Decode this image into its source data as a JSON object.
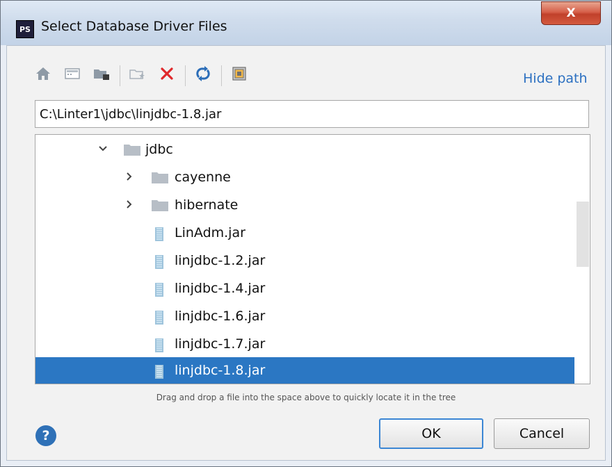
{
  "window": {
    "title": "Select Database Driver Files",
    "app_icon_label": "PS",
    "close_glyph": "X"
  },
  "toolbar": {
    "icons": [
      "home-icon",
      "desktop-icon",
      "project-folder-icon",
      "new-folder-icon",
      "delete-icon",
      "refresh-icon",
      "show-hidden-icon"
    ],
    "hide_path_label": "Hide path"
  },
  "path": {
    "value": "C:\\Linter1\\jdbc\\linjdbc-1.8.jar"
  },
  "tree": {
    "items": [
      {
        "label": "jdbc",
        "type": "folder",
        "expanded": true,
        "depth": 0
      },
      {
        "label": "cayenne",
        "type": "folder",
        "expanded": false,
        "depth": 1
      },
      {
        "label": "hibernate",
        "type": "folder",
        "expanded": false,
        "depth": 1
      },
      {
        "label": "LinAdm.jar",
        "type": "jar",
        "depth": 1
      },
      {
        "label": "linjdbc-1.2.jar",
        "type": "jar",
        "depth": 1
      },
      {
        "label": "linjdbc-1.4.jar",
        "type": "jar",
        "depth": 1
      },
      {
        "label": "linjdbc-1.6.jar",
        "type": "jar",
        "depth": 1
      },
      {
        "label": "linjdbc-1.7.jar",
        "type": "jar",
        "depth": 1
      },
      {
        "label": "linjdbc-1.8.jar",
        "type": "jar",
        "depth": 1,
        "selected": true
      }
    ]
  },
  "hint": "Drag and drop a file into the space above to quickly locate it in the tree",
  "buttons": {
    "help_glyph": "?",
    "ok_label": "OK",
    "cancel_label": "Cancel"
  },
  "colors": {
    "selection": "#2b77c3",
    "link": "#2c70c1",
    "delete": "#e0282b"
  }
}
